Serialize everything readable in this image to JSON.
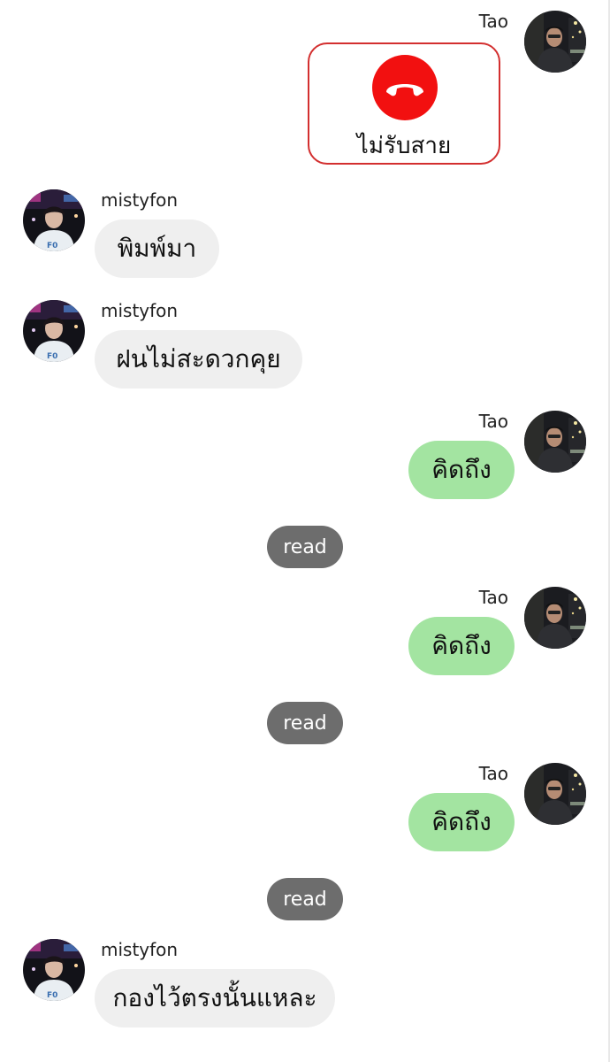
{
  "colors": {
    "incoming_bubble": "#efefef",
    "outgoing_bubble": "#a3e4a1",
    "read_pill": "#6d6d6d",
    "call_declined": "#f21010"
  },
  "call_card": {
    "sender": "Tao",
    "icon": "phone-declined-icon",
    "label": "ไม่รับสาย"
  },
  "messages": [
    {
      "sender": "mistyfon",
      "text": "พิมพ์มา"
    },
    {
      "sender": "mistyfon",
      "text": "ฝนไม่สะดวกคุย"
    },
    {
      "sender": "Tao",
      "text": "คิดถึง"
    },
    {
      "sender": "Tao",
      "text": "คิดถึง"
    },
    {
      "sender": "Tao",
      "text": "คิดถึง"
    },
    {
      "sender": "mistyfon",
      "text": "กองไว้ตรงนั้นแหละ"
    }
  ],
  "read_receipts": [
    "read",
    "read",
    "read"
  ]
}
